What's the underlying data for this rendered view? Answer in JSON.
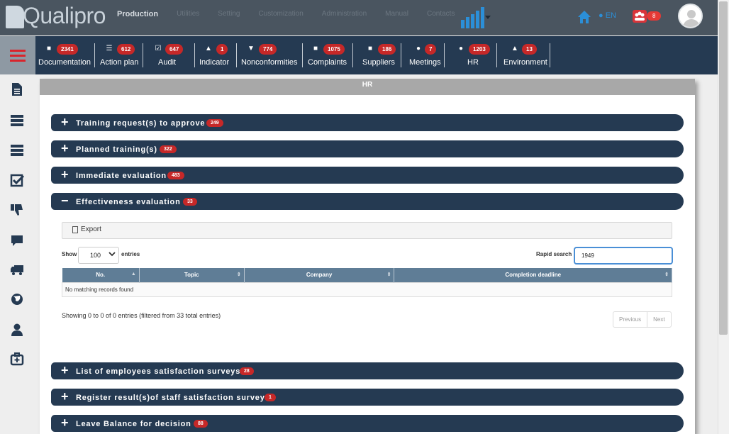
{
  "app": {
    "logo_text": "Qualipro",
    "nav": [
      "Production",
      "Utilities",
      "Setting",
      "Customization",
      "Administration",
      "Manual",
      "Contacts"
    ],
    "language": "EN",
    "notifications_count": "8"
  },
  "modules": [
    {
      "label": "Documentation",
      "count": "2341",
      "icon": "file-icon"
    },
    {
      "label": "Action plan",
      "count": "612",
      "icon": "server-icon"
    },
    {
      "label": "Audit",
      "count": "647",
      "icon": "check-square-icon"
    },
    {
      "label": "Indicator",
      "count": "1",
      "icon": "area-chart-icon"
    },
    {
      "label": "Nonconformities",
      "count": "774",
      "icon": "thumbs-down-icon"
    },
    {
      "label": "Complaints",
      "count": "1075",
      "icon": "comment-icon"
    },
    {
      "label": "Suppliers",
      "count": "186",
      "icon": "truck-icon"
    },
    {
      "label": "Meetings",
      "count": "7",
      "icon": "globe-icon"
    },
    {
      "label": "HR",
      "count": "1203",
      "icon": "user-icon"
    },
    {
      "label": "Environment",
      "count": "13",
      "icon": "bell-icon"
    }
  ],
  "sidebar_icons": [
    "file-icon",
    "server-icon",
    "server-icon",
    "check-square-icon",
    "thumbs-down-icon",
    "comment-icon",
    "truck-icon",
    "globe-icon",
    "user-icon",
    "medkit-icon"
  ],
  "panel": {
    "title": "HR",
    "sections": [
      {
        "title": "Training request(s) to approve",
        "count": "249",
        "expanded": false
      },
      {
        "title": "Planned training(s)",
        "count": "322",
        "expanded": false
      },
      {
        "title": "Immediate evaluation",
        "count": "483",
        "expanded": false
      },
      {
        "title": "Effectiveness evaluation",
        "count": "33",
        "expanded": true
      },
      {
        "title": "List of employees satisfaction surveys",
        "count": "28",
        "expanded": false
      },
      {
        "title": "Register result(s)of staff satisfaction survey",
        "count": "1",
        "expanded": false
      },
      {
        "title": "Leave Balance for decision",
        "count": "88",
        "expanded": false
      }
    ]
  },
  "table": {
    "export_label": "Export",
    "show_label": "Show",
    "entries_value": "100",
    "entries_label": "entries",
    "search_label": "Rapid search",
    "search_value": "1949",
    "columns": [
      "No.",
      "Topic",
      "Company",
      "Completion deadline"
    ],
    "empty_message": "No matching records found",
    "info": "Showing 0 to 0 of 0 entries (filtered from 33 total entries)",
    "prev_label": "Previous",
    "next_label": "Next"
  },
  "colors": {
    "navy": "#253a52",
    "badge_red": "#c62828",
    "topbar": "#4a5560",
    "table_header": "#5f7d96",
    "accent_blue": "#2b8fd8"
  }
}
